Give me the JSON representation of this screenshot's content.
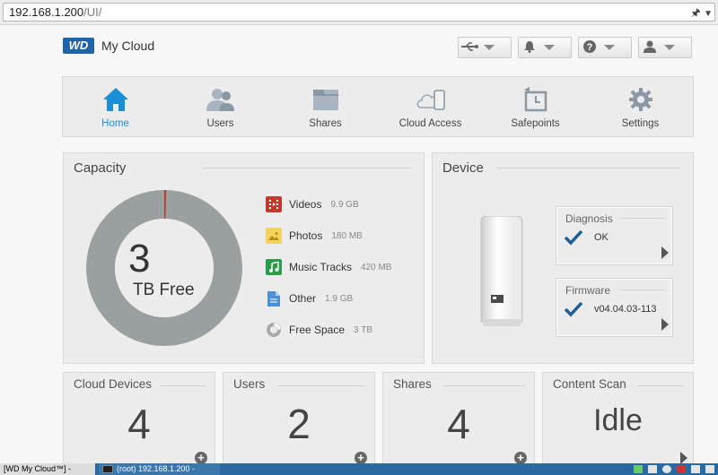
{
  "browser": {
    "url_host": "192.168.1.200",
    "url_path": "/UI/"
  },
  "header": {
    "logo_mark": "WD",
    "logo_text": "My Cloud",
    "buttons": [
      {
        "icon": "usb-icon"
      },
      {
        "icon": "bell-icon"
      },
      {
        "icon": "help-icon"
      },
      {
        "icon": "user-icon"
      }
    ]
  },
  "nav": {
    "items": [
      {
        "label": "Home",
        "icon": "home-icon",
        "active": true
      },
      {
        "label": "Users",
        "icon": "users-icon"
      },
      {
        "label": "Shares",
        "icon": "folder-icon"
      },
      {
        "label": "Cloud Access",
        "icon": "cloud-access-icon"
      },
      {
        "label": "Safepoints",
        "icon": "safepoint-icon"
      },
      {
        "label": "Settings",
        "icon": "gear-icon"
      }
    ]
  },
  "capacity": {
    "title": "Capacity",
    "free_value": "3",
    "free_unit": "TB Free",
    "used_fraction": 0.003,
    "legend": [
      {
        "label": "Videos",
        "size": "9.9 GB",
        "color": "#c0392b",
        "icon": "film-icon"
      },
      {
        "label": "Photos",
        "size": "180 MB",
        "color": "#e9c22c",
        "icon": "photo-icon"
      },
      {
        "label": "Music Tracks",
        "size": "420 MB",
        "color": "#2e9b4a",
        "icon": "music-icon"
      },
      {
        "label": "Other",
        "size": "1.9 GB",
        "color": "#4a90d6",
        "icon": "document-icon"
      },
      {
        "label": "Free Space",
        "size": "3 TB",
        "color": "#999999",
        "icon": "pie-icon"
      }
    ]
  },
  "device": {
    "title": "Device",
    "diagnosis": {
      "title": "Diagnosis",
      "value": "OK"
    },
    "firmware": {
      "title": "Firmware",
      "value": "v04.04.03-113"
    }
  },
  "stats": [
    {
      "title": "Cloud Devices",
      "value": "4",
      "action": "add"
    },
    {
      "title": "Users",
      "value": "2",
      "action": "add"
    },
    {
      "title": "Shares",
      "value": "4",
      "action": "add"
    },
    {
      "title": "Content Scan",
      "value": "Idle",
      "action": "open"
    }
  ],
  "taskbar": {
    "task1": "[WD My Cloud™] -",
    "task2": "(root) 192.168.1.200 -"
  }
}
